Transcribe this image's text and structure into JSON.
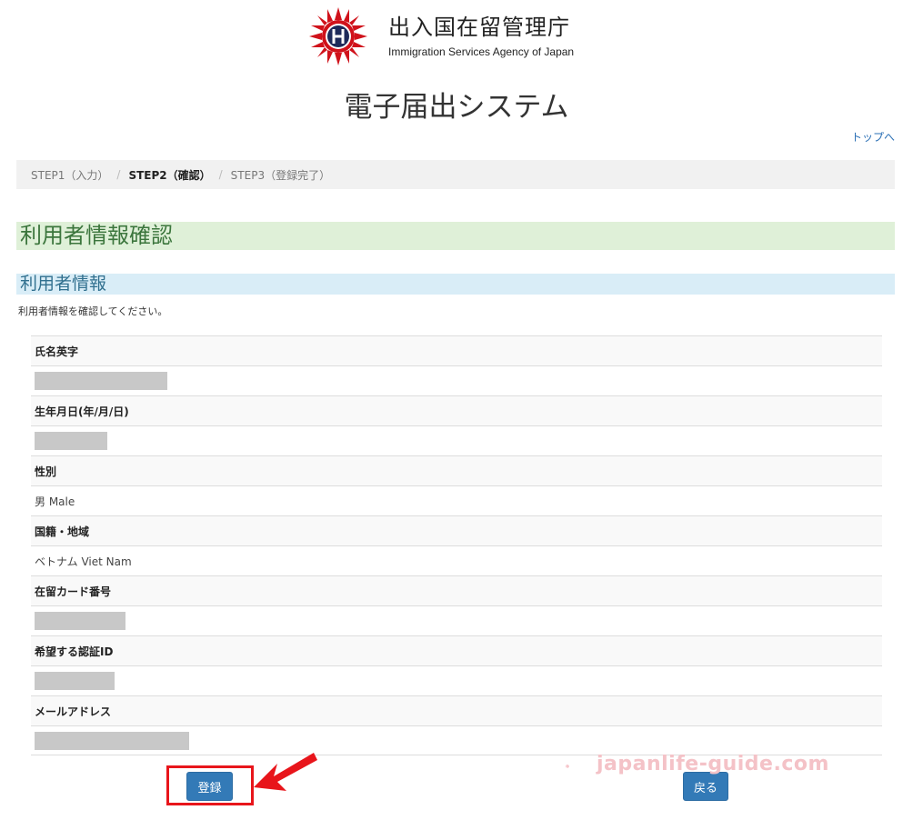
{
  "header": {
    "agency_name_jp": "出入国在留管理庁",
    "agency_name_en": "Immigration Services Agency of Japan",
    "system_title": "電子届出システム",
    "top_link": "トップへ"
  },
  "breadcrumb": {
    "steps": [
      {
        "label": "STEP1（入力）",
        "active": false
      },
      {
        "label": "STEP2（確認）",
        "active": true
      },
      {
        "label": "STEP3（登録完了）",
        "active": false
      }
    ],
    "separator": "/"
  },
  "page": {
    "heading": "利用者情報確認",
    "section_heading": "利用者情報",
    "instructions": "利用者情報を確認してください。"
  },
  "fields": [
    {
      "label": "氏名英字",
      "value": "",
      "redacted": true
    },
    {
      "label": "生年月日(年/月/日)",
      "value": "",
      "redacted": true
    },
    {
      "label": "性別",
      "value": "男 Male",
      "redacted": false
    },
    {
      "label": "国籍・地域",
      "value": "ベトナム Viet Nam",
      "redacted": false
    },
    {
      "label": "在留カード番号",
      "value": "",
      "redacted": true
    },
    {
      "label": "希望する認証ID",
      "value": "",
      "redacted": true
    },
    {
      "label": "メールアドレス",
      "value": "",
      "redacted": true
    }
  ],
  "buttons": {
    "register": "登録",
    "back": "戻る"
  },
  "watermark": "japanlife-guide.com",
  "colors": {
    "link": "#2a6fb5",
    "primary_button": "#337ab7",
    "success_bg": "#dff0d8",
    "info_bg": "#d9edf7",
    "highlight": "#e8151b"
  }
}
